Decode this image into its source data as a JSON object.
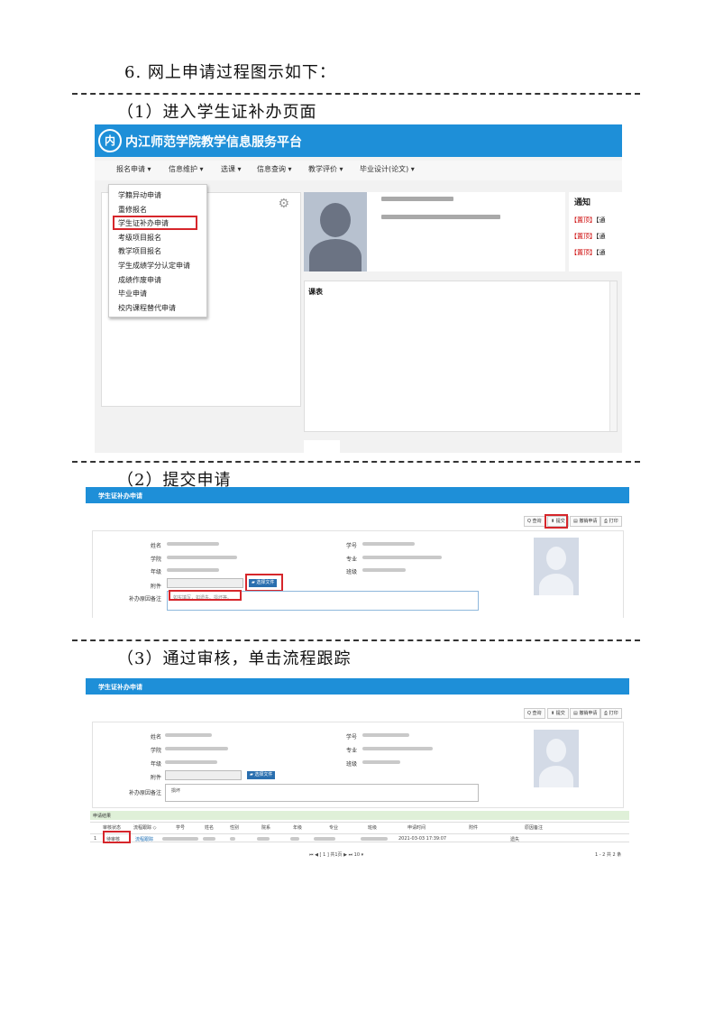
{
  "doc": {
    "title": "6. 网上申请过程图示如下：",
    "step1": "（1）进入学生证补办页面",
    "step2": "（2）提交申请",
    "step3": "（3）通过审核，单击流程跟踪"
  },
  "shot1": {
    "platform_title": "内江师范学院教学信息服务平台",
    "nav": [
      "报名申请 ▾",
      "信息维护 ▾",
      "选课 ▾",
      "信息查询 ▾",
      "教学评价 ▾",
      "毕业设计(论文) ▾"
    ],
    "menu": [
      "学籍异动申请",
      "重修报名",
      "学生证补办申请",
      "考级项目报名",
      "教学项目报名",
      "学生成绩学分认定申请",
      "成绩作废申请",
      "毕业申请",
      "校内课程替代申请"
    ],
    "notice_title": "通知",
    "notice_tag": "【置顶】",
    "notice_tail": "【通",
    "schedule_label": "课表"
  },
  "shot2": {
    "header": "学生证补办申请",
    "buttons": [
      "Q 查询",
      "⬆ 提交",
      "▤ 撤销申请",
      "⎙ 打印"
    ],
    "labels_left": [
      "姓名",
      "学院",
      "年级",
      "附件",
      "补办原因备注"
    ],
    "labels_right": [
      "学号",
      "专业",
      "班级"
    ],
    "file_btn": "▰ 选择文件",
    "reason_placeholder": "如实填写，如遗失、损坏等。"
  },
  "shot3": {
    "header": "学生证补办申请",
    "buttons": [
      "Q 查询",
      "⬆ 提交",
      "▤ 撤销申请",
      "⎙ 打印"
    ],
    "labels_left": [
      "姓名",
      "学院",
      "年级",
      "附件",
      "补办原因备注"
    ],
    "labels_right": [
      "学号",
      "专业",
      "班级"
    ],
    "file_btn": "▰ 选择文件",
    "reason_value": "损坏",
    "result_label": "申请结果",
    "columns": [
      "审核状态",
      "流程跟踪 ◇",
      "学号",
      "姓名",
      "性别",
      "院系",
      "年级",
      "专业",
      "班级",
      "申请时间",
      "附件",
      "原因备注"
    ],
    "row": {
      "index": "1",
      "status": "待审核",
      "track": "流程跟踪",
      "time": "2021-03-03 17:39:07",
      "reason": "遗失"
    },
    "pager": "⏮ ◀ [ 1 ] 共1页 ▶ ⏭ 10 ▾",
    "pager_right": "1 - 2  共 2 条"
  }
}
